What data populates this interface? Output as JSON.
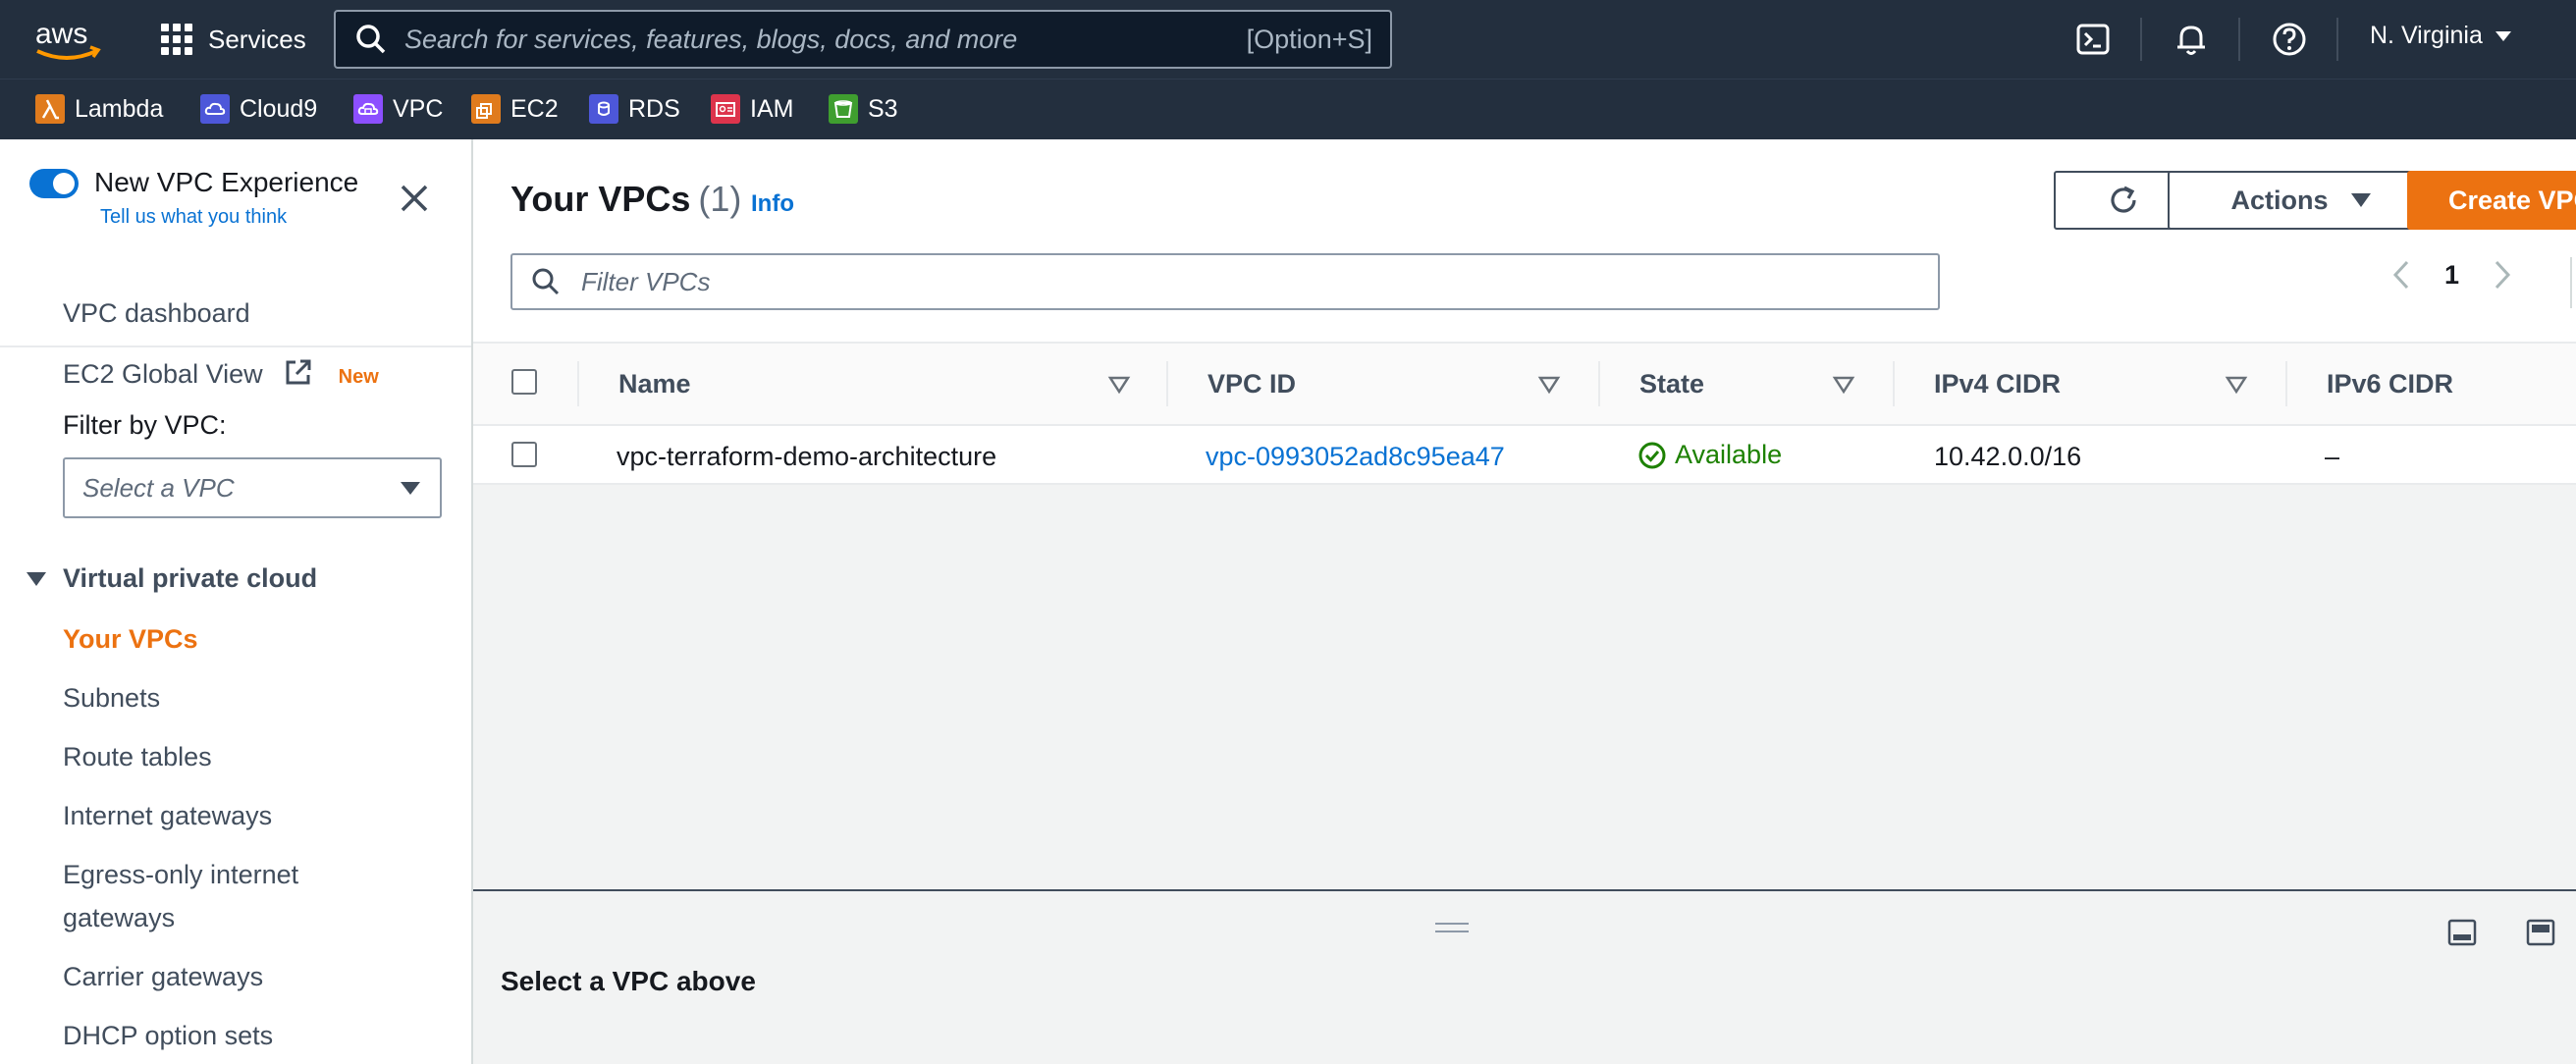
{
  "topbar": {
    "logo_text": "aws",
    "services_label": "Services",
    "search_placeholder": "Search for services, features, blogs, docs, and more",
    "search_shortcut": "[Option+S]",
    "region": "N. Virginia"
  },
  "favorites": [
    {
      "label": "Lambda",
      "color": "#e07b1d"
    },
    {
      "label": "Cloud9",
      "color": "#4d57d9"
    },
    {
      "label": "VPC",
      "color": "#8c4fff"
    },
    {
      "label": "EC2",
      "color": "#e07b1d"
    },
    {
      "label": "RDS",
      "color": "#4d57d9"
    },
    {
      "label": "IAM",
      "color": "#dd344c"
    },
    {
      "label": "S3",
      "color": "#3f9e2f"
    }
  ],
  "sidebar": {
    "experience_title": "New VPC Experience",
    "experience_link": "Tell us what you think",
    "dashboard": "VPC dashboard",
    "global_view": "EC2 Global View",
    "new_badge": "New",
    "filter_label": "Filter by VPC:",
    "filter_placeholder": "Select a VPC",
    "section": "Virtual private cloud",
    "items": [
      "Your VPCs",
      "Subnets",
      "Route tables",
      "Internet gateways",
      "Egress-only internet",
      "gateways",
      "Carrier gateways",
      "DHCP option sets"
    ]
  },
  "main": {
    "title": "Your VPCs",
    "count": "(1)",
    "info": "Info",
    "actions_label": "Actions",
    "create_label": "Create VPC",
    "filter_placeholder": "Filter VPCs",
    "page_number": "1",
    "columns": [
      "Name",
      "VPC ID",
      "State",
      "IPv4 CIDR",
      "IPv6 CIDR"
    ],
    "row": {
      "name": "vpc-terraform-demo-architecture",
      "vpc_id": "vpc-0993052ad8c95ea47",
      "state": "Available",
      "ipv4": "10.42.0.0/16",
      "ipv6": "–"
    }
  },
  "split_panel": {
    "title": "Select a VPC above"
  },
  "colors": {
    "nav_bg": "#232f3e",
    "accent_orange": "#ec7211",
    "link_blue": "#0972d3",
    "success_green": "#1d8102"
  }
}
